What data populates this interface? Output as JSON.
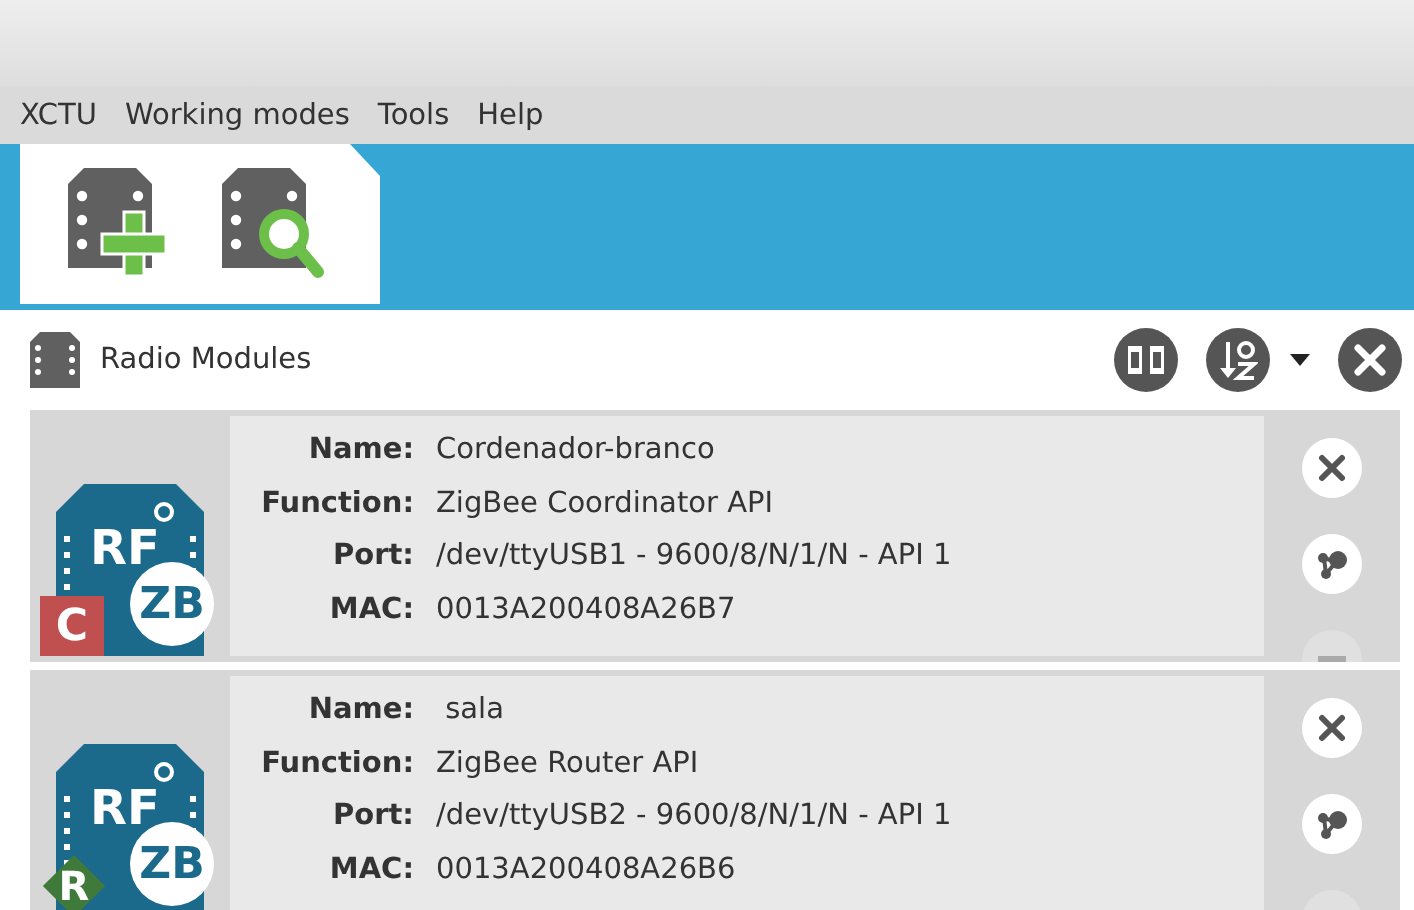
{
  "menu": [
    "XCTU",
    "Working modes",
    "Tools",
    "Help"
  ],
  "panel": {
    "title": "Radio Modules"
  },
  "modules": [
    {
      "chip_label": "RF",
      "protocol": "ZB",
      "role": {
        "letter": "C",
        "kind": "coordinator",
        "color": "#c05050"
      },
      "fields": [
        {
          "label": "Name:",
          "value": "Cordenador-branco"
        },
        {
          "label": "Function:",
          "value": "ZigBee Coordinator API"
        },
        {
          "label": "Port:",
          "value": "/dev/ttyUSB1 - 9600/8/N/1/N - API 1"
        },
        {
          "label": "MAC:",
          "value": "0013A200408A26B7"
        }
      ]
    },
    {
      "chip_label": "RF",
      "protocol": "ZB",
      "role": {
        "letter": "R",
        "kind": "router",
        "color": "#3f7a3a"
      },
      "fields": [
        {
          "label": "Name:",
          "value": " sala"
        },
        {
          "label": "Function:",
          "value": "ZigBee Router API"
        },
        {
          "label": "Port:",
          "value": "/dev/ttyUSB2 - 9600/8/N/1/N - API 1"
        },
        {
          "label": "MAC:",
          "value": "0013A200408A26B6"
        }
      ]
    }
  ]
}
